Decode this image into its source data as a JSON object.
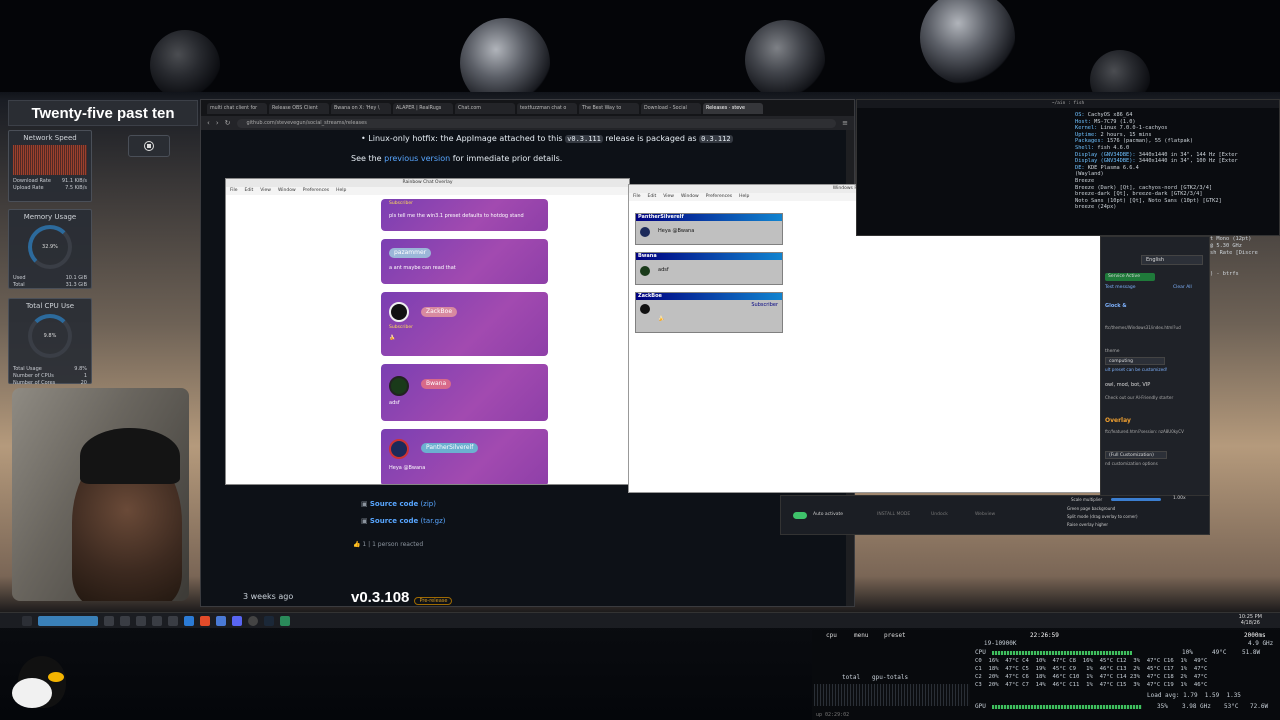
{
  "clock": "Twenty-five past ten",
  "widgets": {
    "network": {
      "title": "Network Speed",
      "download_label": "Download Rate",
      "download_value": "91.1 KiB/s",
      "upload_label": "Upload Rate",
      "upload_value": "7.5 KiB/s"
    },
    "memory": {
      "title": "Memory Usage",
      "percent": "32.9%",
      "used_label": "Used",
      "used_value": "10.1 GiB",
      "total_label": "Total",
      "total_value": "31.3 GiB"
    },
    "cpu": {
      "title": "Total CPU Use",
      "percent": "9.8%",
      "rows": [
        {
          "label": "Total Usage",
          "value": "9.8%"
        },
        {
          "label": "Number of CPUs",
          "value": "1"
        },
        {
          "label": "Number of Cores",
          "value": "20"
        }
      ]
    }
  },
  "browser": {
    "tabs": [
      "multi chat client for",
      "Release OBS Client",
      "Bwana on X: 'Hey \\",
      "ALAPER | RealRugs",
      "Chat.com",
      "textfuzzman chat o",
      "The Best Way to",
      "Download - Social",
      "Releases · steve"
    ],
    "active_tab": 8,
    "url": "github.com/stevevegun/social_streams/releases",
    "bullet_text": "Linux-only hotfix: the AppImage attached to this",
    "bullet_code1": "v0.3.111",
    "bullet_text2": "release is packaged as",
    "bullet_code2": "0.3.112",
    "see_prefix": "See the",
    "see_link": "previous version",
    "see_suffix": "for immediate prior details.",
    "assets": [
      {
        "label": "Source code",
        "ext": "(zip)"
      },
      {
        "label": "Source code",
        "ext": "(tar.gz)"
      }
    ],
    "reaction_emoji": "👍",
    "reaction_count": "1",
    "reaction_text": "1 person reacted",
    "timestamp": "3 weeks ago",
    "version": "v0.3.108",
    "badge": "Pre-release"
  },
  "rainbow": {
    "title": "Rainbow Chat Overlay",
    "menu": [
      "File",
      "Edit",
      "View",
      "Window",
      "Preferences",
      "Help"
    ],
    "messages": [
      {
        "user": "",
        "subtag": "Subscriber",
        "text": "pls tell me the win3.1 preset defaults to hotdog stand"
      },
      {
        "user": "pazammer",
        "subtag": "",
        "text": "a ant maybe can read that"
      },
      {
        "user": "ZackBoe",
        "subtag": "Subscriber",
        "text": "🍌"
      },
      {
        "user": "Bwana",
        "subtag": "",
        "text": "adsf"
      },
      {
        "user": "PantherSilverelf",
        "subtag": "",
        "text": "Heya @Bwana"
      }
    ]
  },
  "retro": {
    "title": "Windows Retro - Chat Overlay",
    "menu": [
      "File",
      "Edit",
      "View",
      "Window",
      "Preferences",
      "Help"
    ],
    "messages": [
      {
        "user": "PantherSilverelf",
        "text": "Heya @Bwana",
        "tag": ""
      },
      {
        "user": "Bwana",
        "text": "adsf",
        "tag": ""
      },
      {
        "user": "ZackBoe",
        "text": "🍌",
        "tag": "Subscriber"
      }
    ]
  },
  "terminal": {
    "title": "~/ain : fish",
    "lines": [
      {
        "key": "OS:",
        "val": "CachyOS x86_64"
      },
      {
        "key": "Host:",
        "val": "MS-7C79 (1.0)"
      },
      {
        "key": "Kernel:",
        "val": "Linux 7.0.0-1-cachyos"
      },
      {
        "key": "Uptime:",
        "val": "2 hours, 15 mins"
      },
      {
        "key": "Packages:",
        "val": "1576 (pacman), 55 (flatpak)"
      },
      {
        "key": "Shell:",
        "val": "fish 4.6.0"
      },
      {
        "key": "Display (GNV34DBE):",
        "val": "3440x1440 in 34\", 144 Hz [Exter"
      },
      {
        "key": "Display (GNV34DBE):",
        "val": "3440x1440 in 34\", 100 Hz [Exter"
      },
      {
        "key": "DE:",
        "val": "KDE Plasma 6.6.4"
      },
      {
        "key": "",
        "val": "(Wayland)"
      },
      {
        "key": "",
        "val": "Breeze"
      },
      {
        "key": "",
        "val": "Breeze (Dark) [Qt], cachyos-nord [GTK2/3/4]"
      },
      {
        "key": "",
        "val": "breeze-dark [Qt], breeze-dark [GTK2/3/4]"
      },
      {
        "key": "",
        "val": "Noto Sans (10pt) [Qt], Noto Sans (10pt) [GTK2]"
      },
      {
        "key": "",
        "val": "breeze (24px)"
      }
    ]
  },
  "settings": {
    "language": "English",
    "service": "Service Active",
    "test_message": "Test message",
    "clear_all": "Clear All",
    "rows": [
      "Glock &",
      "ftc/themes/Windows31/index.html?ucl",
      "theme",
      "computing",
      "ult preset can be customized!",
      "owl, mod, bot, VIP",
      "Check out our AI-Friendly starter",
      "Overlay",
      "ftc/featured.html?session: nzA8U0kyCV",
      "(Full Customization)",
      "nd customization options"
    ],
    "right_lines": [
      "t Mono (12pt)",
      "@ 5.30 GHz",
      "sh Rate [Discre",
      ") - btrfs"
    ]
  },
  "bottompanel": {
    "auto_activate": "Auto activate",
    "install_mode": "INSTALL MODE",
    "undock": "Undock",
    "webview": "Webview",
    "scale_label": "Scale multiplier",
    "scale_value": "1.00x",
    "options": [
      "Green page background",
      "Split mode (drag overlay to corner)",
      "Raise overlay higher"
    ]
  },
  "taskbar": {
    "time": "10:25 PM",
    "date": "4/18/26"
  },
  "btop": {
    "tabs": [
      "cpu",
      "menu",
      "preset"
    ],
    "time": "22:26:59",
    "interval": "2000ms",
    "cpu_model": "i9-10900K",
    "freq": "4.9 GHz",
    "cpu_label": "CPU",
    "cpu_pct": "10%",
    "cpu_temp": "49°C",
    "cpu_watts": "51.8W",
    "core_lines": [
      "C0  16%  47°C C4  10%  47°C C8  16%  45°C C12  3%  47°C C16  1%  49°C",
      "C1  18%  47°C C5  19%  45°C C9   1%  46°C C13  2%  45°C C17  1%  47°C",
      "C2  20%  47°C C6  18%  46°C C10  1%  47°C C14 23%  47°C C18  2%  47°C",
      "C3  20%  47°C C7  14%  46°C C11  1%  47°C C15  3%  47°C C19  1%  46°C"
    ],
    "load": "Load avg: 1.79  1.59  1.35",
    "total_label": "total",
    "gpu_totals": "gpu-totals",
    "gpu_label": "GPU",
    "gpu_pct": "35%",
    "gpu_mem": "3.98 GHz",
    "gpu_vram": "53°C",
    "gpu_pct2": "72.6W",
    "uptime": "up 02:29:02"
  }
}
